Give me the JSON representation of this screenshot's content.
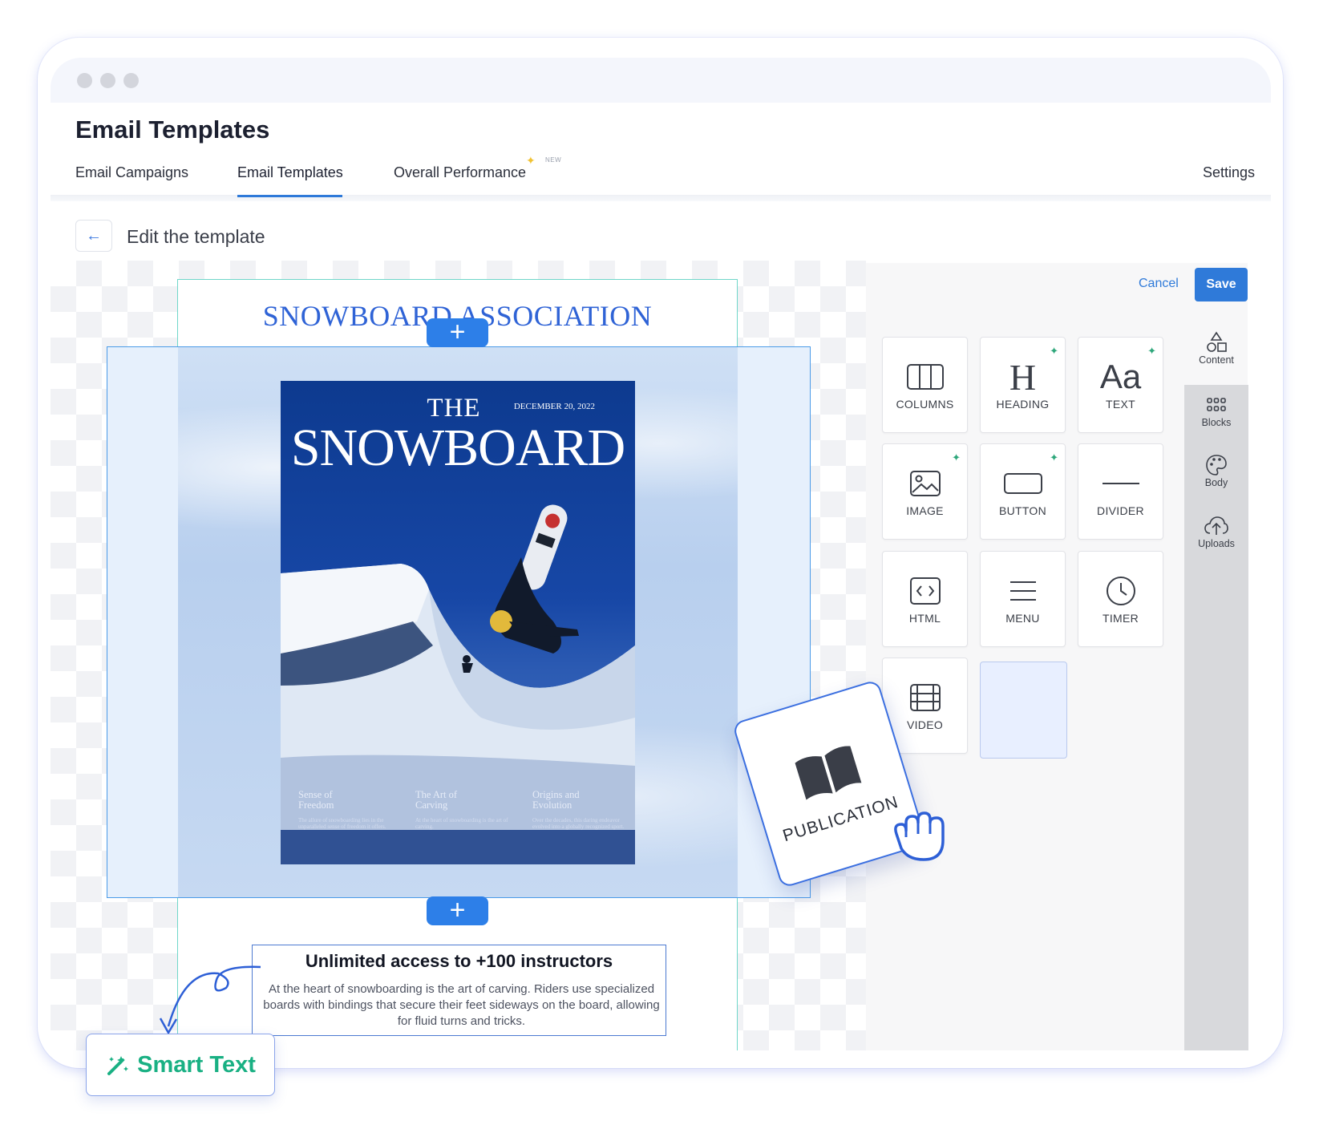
{
  "page": {
    "title": "Email Templates"
  },
  "tabs": [
    {
      "label": "Email Campaigns"
    },
    {
      "label": "Email Templates"
    },
    {
      "label": "Overall Performance",
      "badge": "NEW"
    },
    {
      "label": "Settings"
    }
  ],
  "editor": {
    "title": "Edit the template",
    "cancel_label": "Cancel",
    "save_label": "Save"
  },
  "email": {
    "brand": "SNOWBOARD ASSOCIATION",
    "cover": {
      "the": "THE",
      "title": "SNOWBOARD",
      "date": "DECEMBER 20, 2022",
      "columns": [
        {
          "heading_line1": "Sense of",
          "heading_line2": "Freedom",
          "body": "The allure of snowboarding lies in the unparalleled sense of freedom it offers."
        },
        {
          "heading_line1": "The Art of",
          "heading_line2": "Carving",
          "body": "At the heart of snowboarding is the art of carving."
        },
        {
          "heading_line1": "Origins and",
          "heading_line2": "Evolution",
          "body": "Over the decades, this daring endeavor evolved into a globally recognized sport."
        }
      ]
    },
    "text_block": {
      "heading": "Unlimited access to +100 instructors",
      "body": "At the heart of snowboarding is the art of carving. Riders use specialized boards with bindings that secure their feet sideways on the board, allowing for fluid turns and tricks."
    }
  },
  "smart_text": {
    "label": "Smart Text"
  },
  "tools": [
    {
      "label": "COLUMNS",
      "icon": "columns-icon",
      "ai": false
    },
    {
      "label": "HEADING",
      "icon": "heading-icon",
      "ai": true
    },
    {
      "label": "TEXT",
      "icon": "text-icon",
      "ai": true
    },
    {
      "label": "IMAGE",
      "icon": "image-icon",
      "ai": true
    },
    {
      "label": "BUTTON",
      "icon": "button-icon",
      "ai": true
    },
    {
      "label": "DIVIDER",
      "icon": "divider-icon",
      "ai": false
    },
    {
      "label": "HTML",
      "icon": "html-icon",
      "ai": false
    },
    {
      "label": "MENU",
      "icon": "menu-icon",
      "ai": false
    },
    {
      "label": "TIMER",
      "icon": "timer-icon",
      "ai": false
    },
    {
      "label": "VIDEO",
      "icon": "video-icon",
      "ai": false
    }
  ],
  "drag_item": {
    "label": "PUBLICATION",
    "icon": "book-icon"
  },
  "sidebar": [
    {
      "label": "Content",
      "icon": "shapes-icon"
    },
    {
      "label": "Blocks",
      "icon": "grid-icon"
    },
    {
      "label": "Body",
      "icon": "palette-icon"
    },
    {
      "label": "Uploads",
      "icon": "cloud-upload-icon"
    }
  ],
  "colors": {
    "accent": "#2f7ad9",
    "smart_text": "#19b083",
    "cover": "#1747a6"
  }
}
